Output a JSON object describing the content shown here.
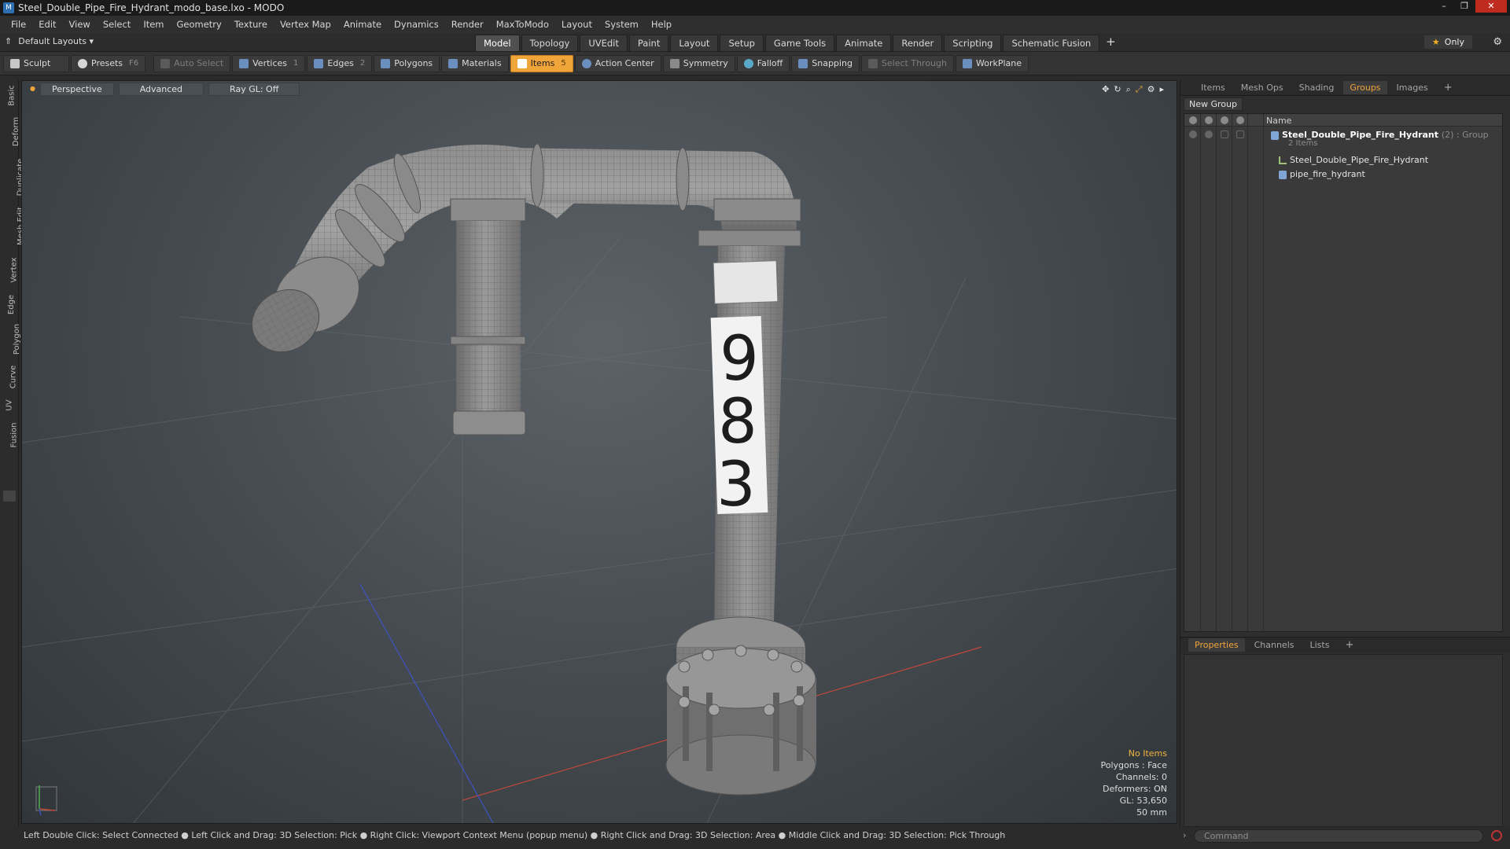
{
  "title": "Steel_Double_Pipe_Fire_Hydrant_modo_base.lxo - MODO",
  "window_controls": {
    "minimize": "–",
    "maximize": "❐",
    "close": "✕"
  },
  "menu": [
    "File",
    "Edit",
    "View",
    "Select",
    "Item",
    "Geometry",
    "Texture",
    "Vertex Map",
    "Animate",
    "Dynamics",
    "Render",
    "MaxToModo",
    "Layout",
    "System",
    "Help"
  ],
  "layouts": {
    "default_label": "Default Layouts ▾",
    "tabs": [
      "Model",
      "Topology",
      "UVEdit",
      "Paint",
      "Layout",
      "Setup",
      "Game Tools",
      "Animate",
      "Render",
      "Scripting",
      "Schematic Fusion"
    ],
    "active_tab": "Model",
    "plus": "+",
    "only_label": "Only",
    "only_star": "★",
    "gear": "⚙"
  },
  "toolbar": {
    "sculpt": "Sculpt",
    "presets": "Presets",
    "presets_key": "F6",
    "auto_select": "Auto Select",
    "vertices": "Vertices",
    "vertices_count": "1",
    "edges": "Edges",
    "edges_count": "2",
    "polygons": "Polygons",
    "materials": "Materials",
    "items": "Items",
    "items_count": "5",
    "action_center": "Action Center",
    "symmetry": "Symmetry",
    "falloff": "Falloff",
    "snapping": "Snapping",
    "select_through": "Select Through",
    "workplane": "WorkPlane"
  },
  "left_tabs": [
    "Basic",
    "Deform",
    "Duplicate",
    "Mesh Edit",
    "Vertex",
    "Edge",
    "Polygon",
    "Curve",
    "UV",
    "Fusion"
  ],
  "viewport": {
    "view_mode": "Perspective",
    "shading": "Advanced",
    "raygl": "Ray GL: Off",
    "stats": {
      "no_items": "No Items",
      "polygons": "Polygons : Face",
      "channels": "Channels: 0",
      "deformers": "Deformers: ON",
      "gl": "GL: 53,650",
      "size": "50 mm"
    },
    "hydrant_digits": [
      "9",
      "8",
      "3"
    ]
  },
  "right_panel": {
    "tabs": [
      "Items",
      "Mesh Ops",
      "Shading",
      "Groups",
      "Images"
    ],
    "active_tab": "Groups",
    "plus": "+",
    "new_group": "New Group",
    "name_header": "Name",
    "group": {
      "name": "Steel_Double_Pipe_Fire_Hydrant",
      "suffix": "(2) : Group",
      "count_label": "2 Items",
      "children": [
        "Steel_Double_Pipe_Fire_Hydrant",
        "pipe_fire_hydrant"
      ]
    },
    "prop_tabs": [
      "Properties",
      "Channels",
      "Lists"
    ],
    "prop_active": "Properties"
  },
  "statusbar": {
    "text": "Left Double Click: Select Connected ● Left Click and Drag: 3D Selection: Pick ● Right Click: Viewport Context Menu (popup menu) ● Right Click and Drag: 3D Selection: Area ● Middle Click and Drag: 3D Selection: Pick Through"
  },
  "command": {
    "placeholder": "Command"
  },
  "colors": {
    "accent": "#f0a53a",
    "close": "#c02b20",
    "viewport_bg": "#474d52"
  }
}
